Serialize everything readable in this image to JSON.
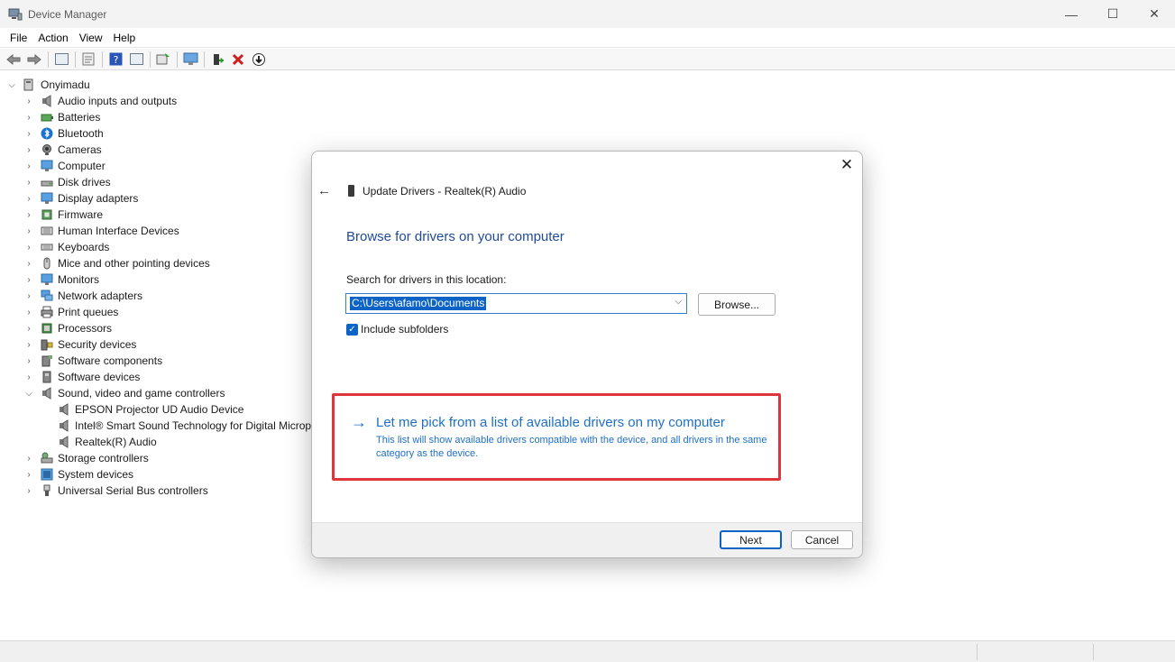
{
  "window": {
    "title": "Device Manager",
    "minimize": "—",
    "maximize": "☐",
    "close": "✕"
  },
  "menu": [
    "File",
    "Action",
    "View",
    "Help"
  ],
  "tree": {
    "root": "Onyimadu",
    "items": [
      "Audio inputs and outputs",
      "Batteries",
      "Bluetooth",
      "Cameras",
      "Computer",
      "Disk drives",
      "Display adapters",
      "Firmware",
      "Human Interface Devices",
      "Keyboards",
      "Mice and other pointing devices",
      "Monitors",
      "Network adapters",
      "Print queues",
      "Processors",
      "Security devices",
      "Software components",
      "Software devices",
      "Sound, video and game controllers"
    ],
    "sound_children": [
      "EPSON Projector UD Audio Device",
      "Intel® Smart Sound Technology for Digital Microphones",
      "Realtek(R) Audio"
    ],
    "items_after": [
      "Storage controllers",
      "System devices",
      "Universal Serial Bus controllers"
    ]
  },
  "dialog": {
    "header": "Update Drivers - Realtek(R) Audio",
    "heading": "Browse for drivers on your computer",
    "search_label": "Search for drivers in this location:",
    "path_value": "C:\\Users\\afamo\\Documents",
    "browse_label": "Browse...",
    "include_subfolders_label": "Include subfolders",
    "include_subfolders_checked": true,
    "pick_title": "Let me pick from a list of available drivers on my computer",
    "pick_desc": "This list will show available drivers compatible with the device, and all drivers in the same category as the device.",
    "next_label": "Next",
    "cancel_label": "Cancel"
  },
  "colors": {
    "link_blue": "#1f6fc5",
    "highlight": "#0b63c7",
    "annotation_red": "#e0343c"
  }
}
